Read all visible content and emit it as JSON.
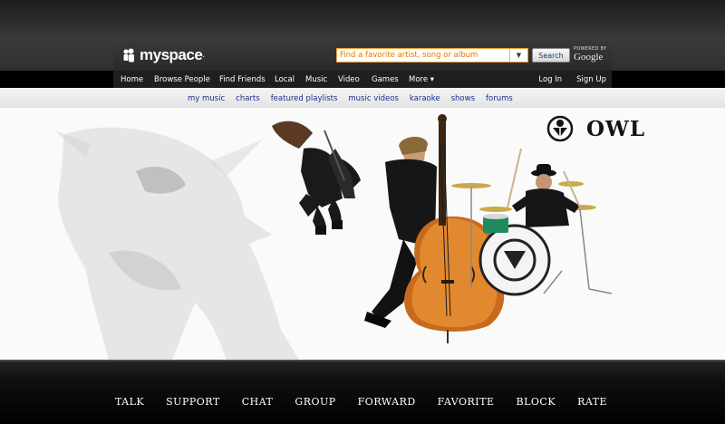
{
  "brand": {
    "logo_text": "myspace",
    "logo_suffix": "."
  },
  "search": {
    "placeholder": "Find a favorite artist, song or album",
    "dropdown_glyph": "▼",
    "button_label": "Search",
    "powered_by": "POWERED BY",
    "provider": "Google"
  },
  "main_nav": {
    "items": [
      "Home",
      "Browse People",
      "Find Friends",
      "Local",
      "Music",
      "Video",
      "Games",
      "More ▾"
    ],
    "right": [
      "Log In",
      "Sign Up"
    ]
  },
  "sub_nav": {
    "items": [
      "my music",
      "charts",
      "featured playlists",
      "music videos",
      "karaoke",
      "shows",
      "forums"
    ]
  },
  "hero": {
    "band_name": "OWL"
  },
  "actions": [
    "TALK",
    "SUPPORT",
    "CHAT",
    "GROUP",
    "FORWARD",
    "FAVORITE",
    "BLOCK",
    "RATE"
  ],
  "colors": {
    "header": "#303030",
    "nav": "#1f1f1f",
    "subnav_link": "#1b2e8a",
    "search_border": "#f0a030",
    "placeholder": "#e07800"
  }
}
